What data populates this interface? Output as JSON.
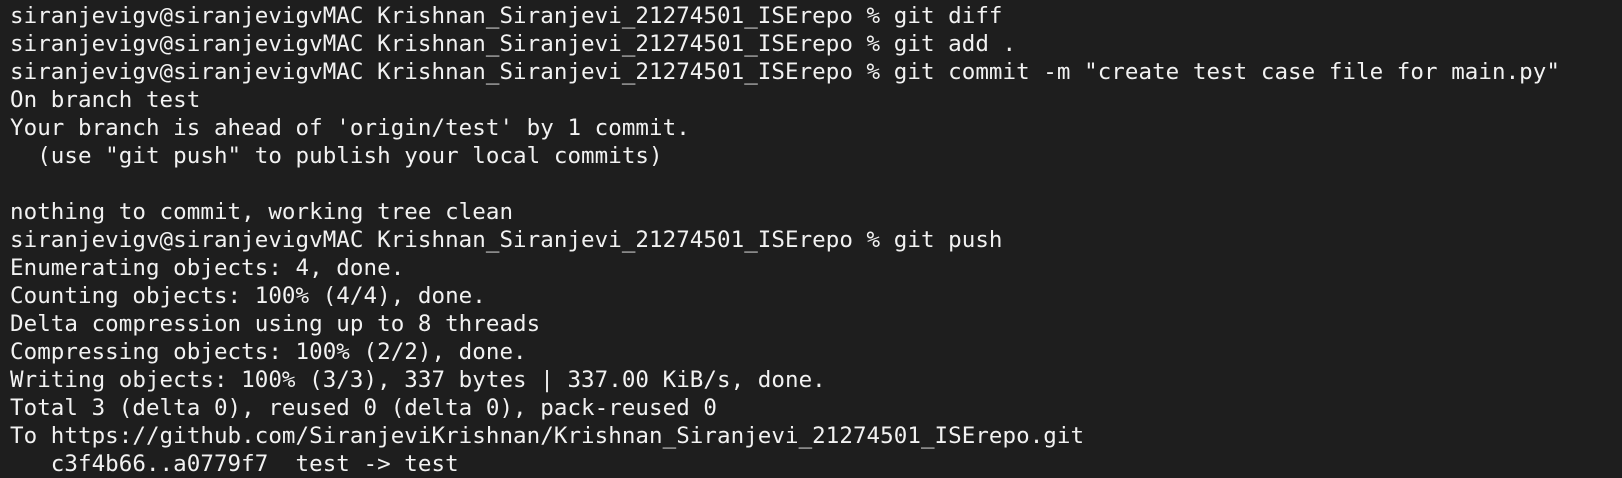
{
  "terminal": {
    "lines": [
      "siranjevigv@siranjevigvMAC Krishnan_Siranjevi_21274501_ISErepo % git diff",
      "siranjevigv@siranjevigvMAC Krishnan_Siranjevi_21274501_ISErepo % git add .",
      "siranjevigv@siranjevigvMAC Krishnan_Siranjevi_21274501_ISErepo % git commit -m \"create test case file for main.py\"",
      "On branch test",
      "Your branch is ahead of 'origin/test' by 1 commit.",
      "  (use \"git push\" to publish your local commits)",
      "",
      "nothing to commit, working tree clean",
      "siranjevigv@siranjevigvMAC Krishnan_Siranjevi_21274501_ISErepo % git push",
      "Enumerating objects: 4, done.",
      "Counting objects: 100% (4/4), done.",
      "Delta compression using up to 8 threads",
      "Compressing objects: 100% (2/2), done.",
      "Writing objects: 100% (3/3), 337 bytes | 337.00 KiB/s, done.",
      "Total 3 (delta 0), reused 0 (delta 0), pack-reused 0",
      "To https://github.com/SiranjeviKrishnan/Krishnan_Siranjevi_21274501_ISErepo.git",
      "   c3f4b66..a0779f7  test -> test"
    ]
  }
}
